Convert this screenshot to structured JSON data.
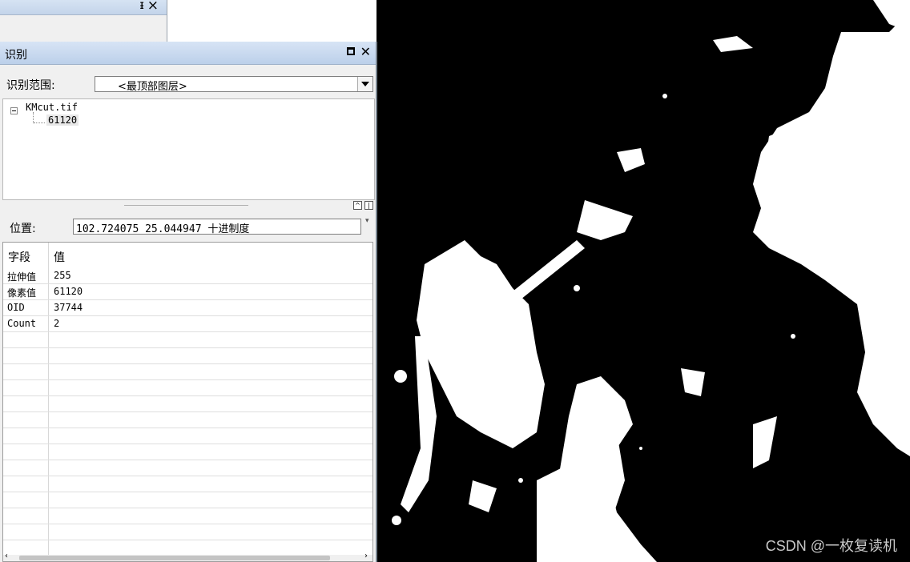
{
  "stub_panel": {
    "pin_icon": "pin-icon",
    "close_icon": "close-icon"
  },
  "identify": {
    "title": "识别",
    "scope_label": "识别范围:",
    "scope_value": "<最顶部图层>",
    "tree": {
      "layer": "KMcut.tif",
      "value": "61120"
    },
    "location_label": "位置:",
    "location_value": "102.724075  25.044947",
    "location_unit": "十进制度",
    "table": {
      "header_field": "字段",
      "header_value": "值",
      "rows": [
        {
          "field": "拉伸值",
          "value": "255"
        },
        {
          "field": "像素值",
          "value": "61120"
        },
        {
          "field": "OID",
          "value": "37744"
        },
        {
          "field": "Count",
          "value": "2"
        }
      ]
    }
  },
  "map": {
    "watermark": "CSDN @一枚复读机",
    "land_color": "#000000",
    "lit_color": "#ffffff"
  }
}
